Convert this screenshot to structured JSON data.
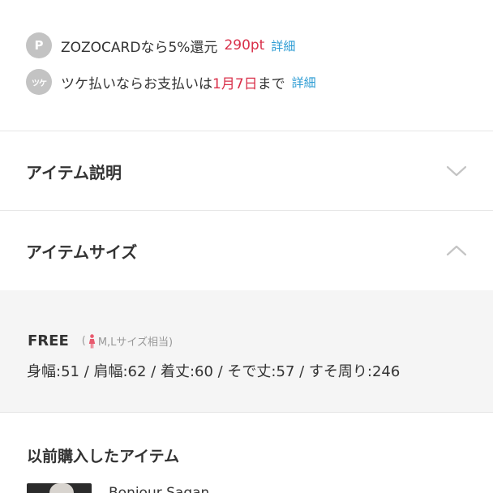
{
  "points": {
    "badge_letter": "P",
    "text": "ZOZOCARDなら5%還元",
    "amount": "290pt",
    "link": "詳細"
  },
  "tsuke": {
    "badge_text": "ツケ",
    "text_before": "ツケ払いならお支払いは",
    "date": "1月7日",
    "text_after": "まで",
    "link": "詳細"
  },
  "accordion": {
    "description_title": "アイテム説明",
    "size_title": "アイテムサイズ"
  },
  "size": {
    "label": "FREE",
    "note_open": "(",
    "note_text": "M,Lサイズ相当)",
    "dimensions": "身幅:51 / 肩幅:62 / 着丈:60 / そで丈:57 / すそ周り:246"
  },
  "previous": {
    "title": "以前購入したアイテム",
    "item_name": "Bonjour Sagan"
  },
  "colors": {
    "accent_red": "#d9304a",
    "link_blue": "#2b9bd3",
    "badge_gray": "#c3c3c3"
  }
}
